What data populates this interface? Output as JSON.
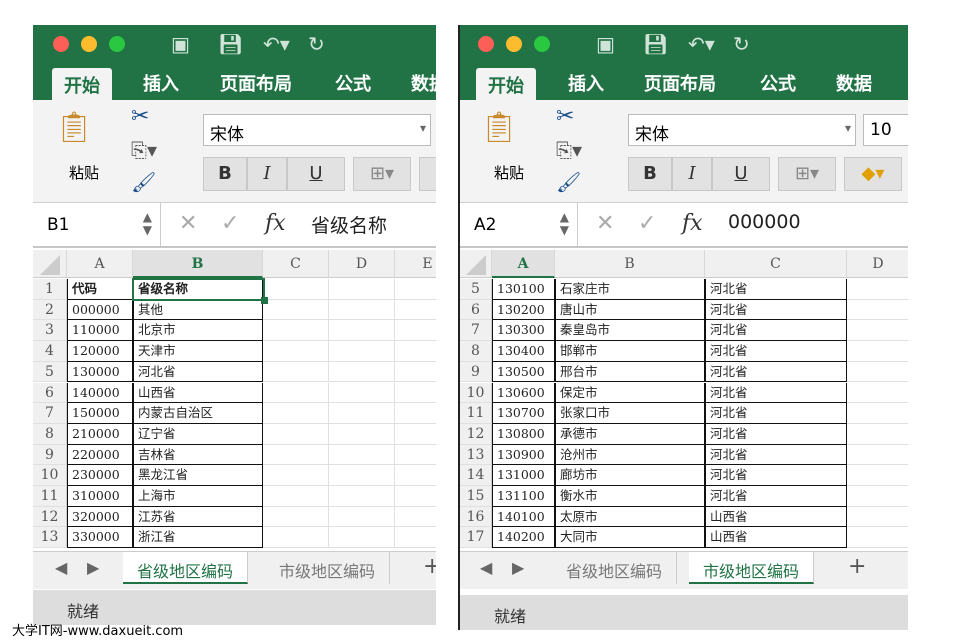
{
  "left": {
    "ribbon_tabs": [
      "开始",
      "插入",
      "页面布局",
      "公式",
      "数据"
    ],
    "paste_label": "粘贴",
    "font_name": "宋体",
    "font_size": "",
    "format_buttons": [
      "B",
      "I",
      "U"
    ],
    "name_box": "B1",
    "formula": "省级名称",
    "columns": [
      "A",
      "B",
      "C",
      "D",
      "E"
    ],
    "selected_column": "B",
    "rows": [
      {
        "n": "1",
        "a": "代码",
        "b": "省级名称"
      },
      {
        "n": "2",
        "a": "000000",
        "b": "其他"
      },
      {
        "n": "3",
        "a": "110000",
        "b": "北京市"
      },
      {
        "n": "4",
        "a": "120000",
        "b": "天津市"
      },
      {
        "n": "5",
        "a": "130000",
        "b": "河北省"
      },
      {
        "n": "6",
        "a": "140000",
        "b": "山西省"
      },
      {
        "n": "7",
        "a": "150000",
        "b": "内蒙古自治区"
      },
      {
        "n": "8",
        "a": "210000",
        "b": "辽宁省"
      },
      {
        "n": "9",
        "a": "220000",
        "b": "吉林省"
      },
      {
        "n": "10",
        "a": "230000",
        "b": "黑龙江省"
      },
      {
        "n": "11",
        "a": "310000",
        "b": "上海市"
      },
      {
        "n": "12",
        "a": "320000",
        "b": "江苏省"
      },
      {
        "n": "13",
        "a": "330000",
        "b": "浙江省"
      }
    ],
    "sheet_tabs": [
      "省级地区编码",
      "市级地区编码"
    ],
    "active_sheet": 0,
    "status": "就绪"
  },
  "right": {
    "ribbon_tabs": [
      "开始",
      "插入",
      "页面布局",
      "公式",
      "数据"
    ],
    "paste_label": "粘贴",
    "font_name": "宋体",
    "font_size": "10",
    "format_buttons": [
      "B",
      "I",
      "U"
    ],
    "name_box": "A2",
    "formula": "000000",
    "columns": [
      "A",
      "B",
      "C",
      "D"
    ],
    "selected_column": "A",
    "rows": [
      {
        "n": "5",
        "a": "130100",
        "b": "石家庄市",
        "c": "河北省"
      },
      {
        "n": "6",
        "a": "130200",
        "b": "唐山市",
        "c": "河北省"
      },
      {
        "n": "7",
        "a": "130300",
        "b": "秦皇岛市",
        "c": "河北省"
      },
      {
        "n": "8",
        "a": "130400",
        "b": "邯郸市",
        "c": "河北省"
      },
      {
        "n": "9",
        "a": "130500",
        "b": "邢台市",
        "c": "河北省"
      },
      {
        "n": "10",
        "a": "130600",
        "b": "保定市",
        "c": "河北省"
      },
      {
        "n": "11",
        "a": "130700",
        "b": "张家口市",
        "c": "河北省"
      },
      {
        "n": "12",
        "a": "130800",
        "b": "承德市",
        "c": "河北省"
      },
      {
        "n": "13",
        "a": "130900",
        "b": "沧州市",
        "c": "河北省"
      },
      {
        "n": "14",
        "a": "131000",
        "b": "廊坊市",
        "c": "河北省"
      },
      {
        "n": "15",
        "a": "131100",
        "b": "衡水市",
        "c": "河北省"
      },
      {
        "n": "16",
        "a": "140100",
        "b": "太原市",
        "c": "山西省"
      },
      {
        "n": "17",
        "a": "140200",
        "b": "大同市",
        "c": "山西省"
      }
    ],
    "sheet_tabs": [
      "省级地区编码",
      "市级地区编码"
    ],
    "active_sheet": 1,
    "status": "就绪"
  },
  "add_sheet": "+",
  "watermark": "大学IT网-www.daxueit.com",
  "colors": {
    "accent": "#217346"
  }
}
